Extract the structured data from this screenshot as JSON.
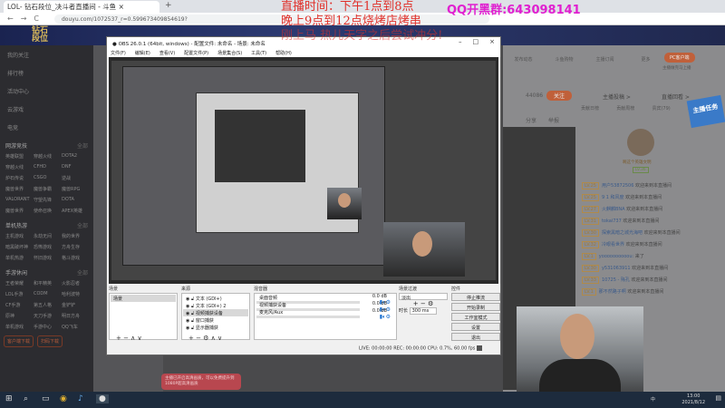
{
  "browser": {
    "tab_title": "LOL- 钻石段位_决斗者直播间 - 斗鱼",
    "tab_close": "×",
    "new_tab": "+",
    "url": "douyu.com/1072537_r=0.599673409854619?",
    "nav": [
      "←",
      "→",
      "C"
    ]
  },
  "banner": {
    "logo": "钻石\n段位"
  },
  "sidebar": {
    "items": [
      "我的关注",
      "排行榜",
      "活动中心",
      "云游戏",
      "电竞"
    ],
    "groups": [
      {
        "title": "网游竞技",
        "more": "全部",
        "items": [
          "英雄联盟",
          "穿越火线",
          "DOTA2",
          "穿越火线",
          "CFHD",
          "DNF",
          "炉石传说",
          "CSGO",
          "逆战",
          "魔兽世界",
          "魔兽争霸",
          "魔兽RPG",
          "VALORANT",
          "守望先锋",
          "DOTA",
          "魔兽世界",
          "使命召唤",
          "APEX英雄"
        ]
      },
      {
        "title": "单机热游",
        "more": "全部",
        "items": [
          "主机游戏",
          "永劫无间",
          "我的世界",
          "暗黑破坏神",
          "恐怖游戏",
          "方舟生存",
          "单机热游",
          "怀旧游戏",
          "格斗游戏"
        ]
      },
      {
        "title": "手游休闲",
        "more": "全部",
        "items": [
          "王者荣耀",
          "和平精英",
          "火影忍者",
          "LOL手游",
          "CODM",
          "哈利波特",
          "CF手游",
          "第五人格",
          "金铲铲",
          "原神",
          "天刀手游",
          "明日方舟",
          "单机游戏",
          "手游中心",
          "QQ飞车"
        ]
      }
    ],
    "buttons": [
      "客户端下载",
      "扫码下载"
    ]
  },
  "right": {
    "tools": [
      "发布动态",
      "斗鱼购物",
      "主播订阅",
      "更多"
    ],
    "pc_button": "PC客户端",
    "pc_sub": "主播做完马上播",
    "follow_count": "44086",
    "follow_button": "关注",
    "share": "分享",
    "report": "举报",
    "links": [
      "主播投稿 >",
      "直播回看 >"
    ],
    "tabs": [
      "贡献日榜",
      "贡献周榜",
      "贵宾(79)",
      "粉丝"
    ],
    "task_badge": "主播任务",
    "host_name": "啊这个英雄文明",
    "host_level": "LV.36",
    "chat": [
      {
        "lv": "LV.25",
        "name": "用户53872506",
        "msg": "欢迎来到本直播间"
      },
      {
        "lv": "LV.25",
        "name": "9 1 和风度",
        "msg": "欢迎来到本直播间"
      },
      {
        "lv": "LV.27",
        "name": "火麒麟BNA",
        "msg": "欢迎来到本直播间"
      },
      {
        "lv": "LV.31",
        "name": "tokai737",
        "msg": "欢迎来到本直播间"
      },
      {
        "lv": "LV.30",
        "name": "探索黑暗之城光海吧",
        "msg": "欢迎来到本直播间"
      },
      {
        "lv": "LV.32",
        "name": "冷眼看世界",
        "msg": "欢迎来到本直播间"
      },
      {
        "lv": "LV.1",
        "name": "yoooooooooou:",
        "msg": "来了"
      },
      {
        "lv": "LV.30",
        "name": "y531063911",
        "msg": "欢迎来到本直播间"
      },
      {
        "lv": "LV.33",
        "name": "10725 - 殇孔",
        "msg": "欢迎来到本直播间"
      },
      {
        "lv": "LV.1",
        "name": "那不然路子啊",
        "msg": "欢迎来到本直播间"
      }
    ]
  },
  "obs": {
    "title": "OBS 26.0.1 (64bit, windows) - 配置文件: 未命名 - 场景: 未命名",
    "menu": [
      "文件(F)",
      "编辑(E)",
      "查看(V)",
      "配置文件(P)",
      "场景集合(S)",
      "工具(T)",
      "帮助(H)"
    ],
    "docks": {
      "scenes": {
        "title": "场景",
        "items": [
          "场景"
        ]
      },
      "sources": {
        "title": "来源",
        "items": [
          "文本 (GDI+)",
          "文本 (GDI+) 2",
          "视频捕获设备",
          "窗口捕获",
          "显示器捕获"
        ]
      },
      "mixer": {
        "title": "混音器",
        "channels": [
          {
            "name": "桌面音频",
            "db": "0.0 dB"
          },
          {
            "name": "视频捕获设备",
            "db": "0.0 dB"
          },
          {
            "name": "麦克风/Aux",
            "db": "0.0 dB"
          }
        ]
      },
      "transitions": {
        "title": "场景过渡",
        "type": "淡出",
        "duration_label": "时长",
        "duration": "300 ms"
      },
      "controls": {
        "title": "控件",
        "buttons": [
          "停止推流",
          "开始录制",
          "工作室模式",
          "设置",
          "退出"
        ]
      }
    },
    "status": "LIVE: 00:00:00    REC: 00:00:00    CPU: 0.7%, 60.00 fps"
  },
  "overlay": {
    "lines": [
      "直播时间：下午1点到8点",
      "晚上9点到12点烧烤店烤串",
      "刚上马 热儿天字之后尝试冲分!"
    ],
    "qq": "QQ开黑群:643098141"
  },
  "toast": "主播已开启高清画质，可以免费提升到1080P超高清画质",
  "taskbar": {
    "time": "13:00",
    "date": "2021/8/12",
    "ime": "中"
  }
}
